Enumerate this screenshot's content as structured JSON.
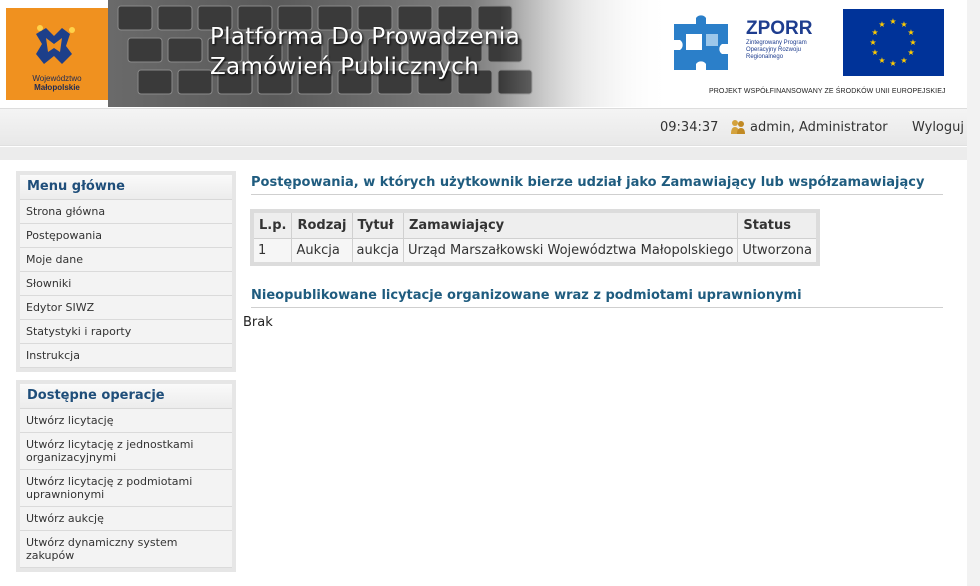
{
  "header": {
    "title_line1": "Platforma Do Prowadzenia",
    "title_line2": "Zamówień Publicznych",
    "logo_line1": "Województwo",
    "logo_line2": "Małopolskie",
    "zporr_name": "ZPORR",
    "zporr_sub": "Zintegrowany Program Operacyjny Rozwoju Regionalnego",
    "eu_caption": "PROJEKT WSPÓŁFINANSOWANY ZE ŚRODKÓW UNII EUROPEJSKIEJ"
  },
  "statusbar": {
    "time": "09:34:37",
    "user": "admin, Administrator",
    "logout": "Wyloguj"
  },
  "menu": {
    "title": "Menu główne",
    "items": [
      "Strona główna",
      "Postępowania",
      "Moje dane",
      "Słowniki",
      "Edytor SIWZ",
      "Statystyki i raporty",
      "Instrukcja"
    ]
  },
  "ops": {
    "title": "Dostępne operacje",
    "items": [
      "Utwórz licytację",
      "Utwórz licytację z jednostkami organizacyjnymi",
      "Utwórz licytację z podmiotami uprawnionymi",
      "Utwórz aukcję",
      "Utwórz dynamiczny system zakupów"
    ]
  },
  "main": {
    "section1_title": "Postępowania, w których użytkownik bierze udział jako Zamawiający lub współzamawiający",
    "table": {
      "headers": [
        "L.p.",
        "Rodzaj",
        "Tytuł",
        "Zamawiający",
        "Status"
      ],
      "rows": [
        [
          "1",
          "Aukcja",
          "aukcja",
          "Urząd Marszałkowski Województwa Małopolskiego",
          "Utworzona"
        ]
      ]
    },
    "section2_title": "Nieopublikowane licytacje organizowane wraz z podmiotami uprawnionymi",
    "empty_text": "Brak"
  },
  "colors": {
    "logo_orange": "#f0911f",
    "eu_blue": "#003399",
    "section_title": "#1f5c7f"
  }
}
